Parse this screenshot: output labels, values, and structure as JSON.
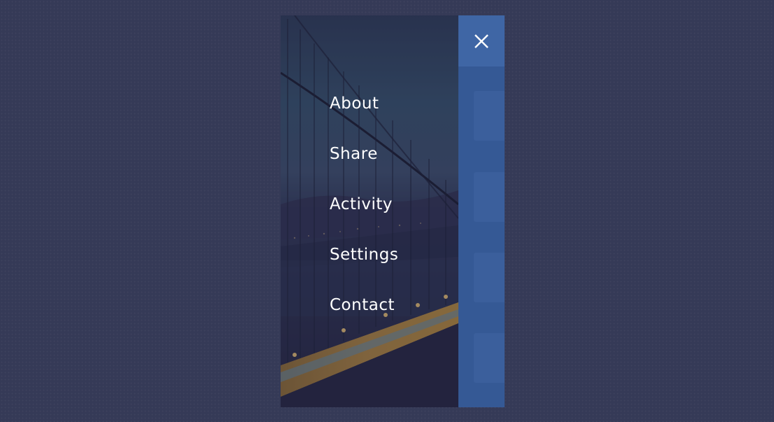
{
  "menu": {
    "items": [
      {
        "label": "About"
      },
      {
        "label": "Share"
      },
      {
        "label": "Activity"
      },
      {
        "label": "Settings"
      },
      {
        "label": "Contact"
      }
    ]
  },
  "header": {
    "close_icon": "close-icon"
  },
  "colors": {
    "page_background": "#353a57",
    "menu_overlay": "#242441",
    "app_blue": "#355995",
    "app_header_blue": "#3f66a5",
    "menu_text": "#ffffff"
  }
}
